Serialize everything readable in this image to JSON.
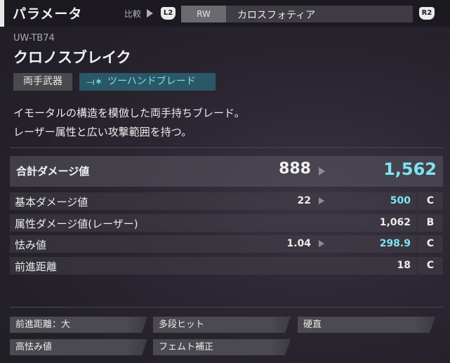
{
  "header": {
    "title": "パラメータ",
    "compare_label": "比較",
    "l2_button": "L2",
    "r2_button": "R2",
    "compare_weapon": {
      "class": "RW",
      "name": "カロスフォティア"
    }
  },
  "weapon": {
    "id": "UW-TB74",
    "name": "クロノスブレイク",
    "tags": {
      "hand": "両手武器",
      "type": "ツーハンドブレード"
    },
    "description": [
      "イモータルの構造を模倣した両手持ちブレード。",
      "レーザー属性と広い攻撃範囲を持つ。"
    ]
  },
  "stats": {
    "total": {
      "label": "合計ダメージ値",
      "compare": "888",
      "value": "1,562"
    },
    "rows": [
      {
        "label": "基本ダメージ値",
        "compare": "22",
        "value": "500",
        "grade": "C"
      },
      {
        "label": "属性ダメージ値(レーザー)",
        "compare": "",
        "value": "1,062",
        "grade": "B"
      },
      {
        "label": "怯み値",
        "compare": "1.04",
        "value": "298.9",
        "grade": "C"
      },
      {
        "label": "前進距離",
        "compare": "",
        "value": "18",
        "grade": "C"
      }
    ]
  },
  "traits": [
    "前進距離：大",
    "多段ヒット",
    "硬直",
    "高怯み値",
    "フェムト補正"
  ],
  "colors": {
    "accent_cyan": "#7fe3f2",
    "type_tag_bg": "#2b5866"
  }
}
